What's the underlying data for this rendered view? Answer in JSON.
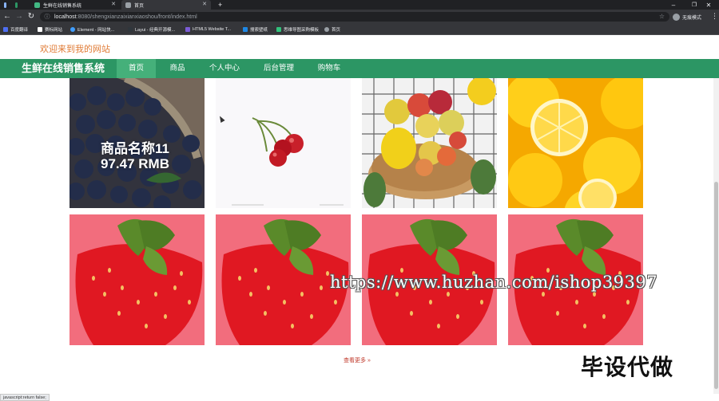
{
  "browser": {
    "tabs": [
      {
        "title": "",
        "favicon_color": "#8ab4f8"
      },
      {
        "title": "",
        "favicon_color": "#2c9664"
      },
      {
        "title": "生鲜在线销售系统",
        "favicon_color": "#42b883"
      },
      {
        "title": "首页",
        "favicon_color": "#9aa0a6"
      }
    ],
    "new_tab": "+",
    "window_controls": [
      "–",
      "❐",
      "✕"
    ],
    "url_host": "localhost",
    "url_path": ":8080/shengxianzaixianxiaoshou/front/index.html",
    "profile_label": "无痕模式",
    "bookmarks": [
      {
        "label": "百度翻译",
        "color": "#4e6ef2"
      },
      {
        "label": "赛标网站",
        "color": "#ffffff"
      },
      {
        "label": "Element - 网站快...",
        "color": "#409eff"
      },
      {
        "label": "Layui - 经典开源模...",
        "color": "#2f363c"
      },
      {
        "label": "HTML5 Website T...",
        "color": "#7b5cd6"
      },
      {
        "label": "搜索壁纸",
        "color": "#1e88e5"
      },
      {
        "label": "思维导图采购模板",
        "color": "#31c27c"
      },
      {
        "label": "首页",
        "color": "#9aa0a6"
      }
    ]
  },
  "page": {
    "welcome": "欢迎来到我的网站",
    "brand": "生鲜在线销售系统",
    "nav": [
      "首页",
      "商品",
      "个人中心",
      "后台管理",
      "购物车"
    ],
    "active_nav": "首页",
    "hovered_product": {
      "name": "商品名称11",
      "price": "97.47 RMB"
    },
    "products": [
      {
        "kind": "blueberry"
      },
      {
        "kind": "cherry"
      },
      {
        "kind": "fruit-basket"
      },
      {
        "kind": "lemon"
      },
      {
        "kind": "strawberry"
      },
      {
        "kind": "strawberry"
      },
      {
        "kind": "strawberry"
      },
      {
        "kind": "strawberry"
      }
    ],
    "more_label": "查看更多 »"
  },
  "watermark": {
    "url": "https://www.huzhan.com/ishop39397",
    "cn": "毕设代做"
  },
  "status_text": "javascript:return false;",
  "colors": {
    "nav_bg": "#2c9664",
    "nav_active": "#45b07a",
    "welcome": "#e07b35",
    "more": "#c0392b"
  }
}
